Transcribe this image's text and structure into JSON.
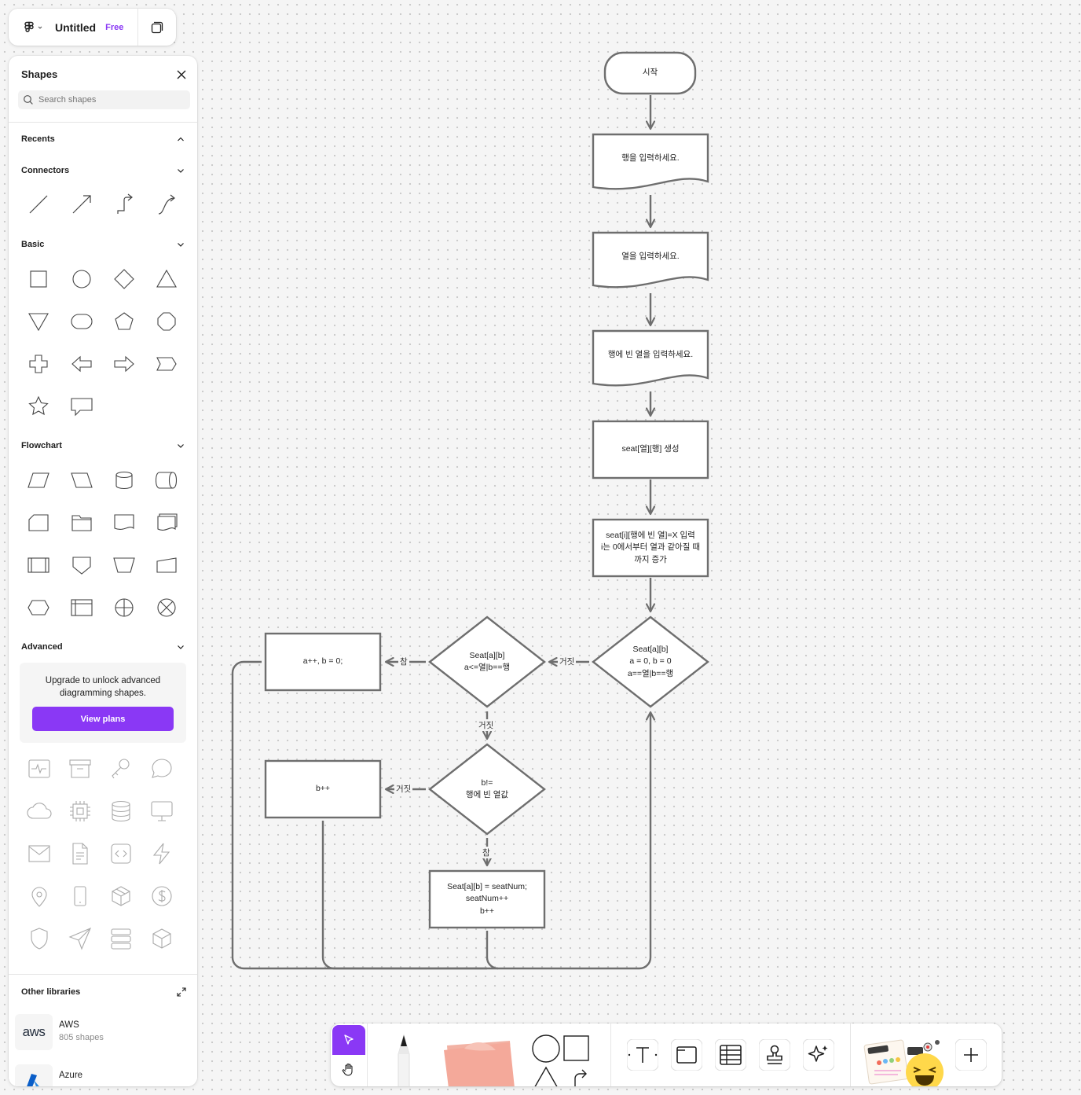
{
  "file": {
    "title": "Untitled",
    "plan_badge": "Free"
  },
  "panel": {
    "title": "Shapes",
    "search_placeholder": "Search shapes",
    "sections": {
      "recents": "Recents",
      "connectors": "Connectors",
      "basic": "Basic",
      "flowchart": "Flowchart",
      "advanced": "Advanced"
    },
    "upgrade_message": "Upgrade to unlock advanced diagramming shapes.",
    "upgrade_button": "View plans",
    "other_libraries": "Other libraries",
    "libraries": [
      {
        "name": "AWS",
        "count": "805 shapes",
        "logo_text": "aws"
      },
      {
        "name": "Azure",
        "count": ""
      }
    ]
  },
  "flowchart": {
    "nodes": {
      "start": "시작",
      "input_rows": "행을 입력하세요.",
      "input_cols": "열을 입력하세요.",
      "input_empty": "행에 빈 열을 입력하세요.",
      "create_seat": "seat[열][행] 생성",
      "mark_empty": "seat[i][행에 빈 열]=X 입력\ni는 0에서부터 열과 같아질 때\n까지 증가",
      "cond1": "Seat[a][b]\na = 0, b = 0\na==열|b==행",
      "cond2": "Seat[a][b]\na<=열|b==행",
      "inc_a": "a++, b = 0;",
      "cond3": "b!=\n행에 빈 열값",
      "inc_b": "b++",
      "assign": "Seat[a][b] = seatNum;\nseatNum++\nb++"
    },
    "edge_labels": {
      "cond1_false": "거짓",
      "cond2_true": "참",
      "cond2_false": "거짓",
      "cond3_false": "거짓",
      "cond3_true": "참"
    }
  },
  "colors": {
    "accent": "#8a38f5",
    "stroke": "#6e6e6e",
    "sticky": "#f4a99a"
  }
}
